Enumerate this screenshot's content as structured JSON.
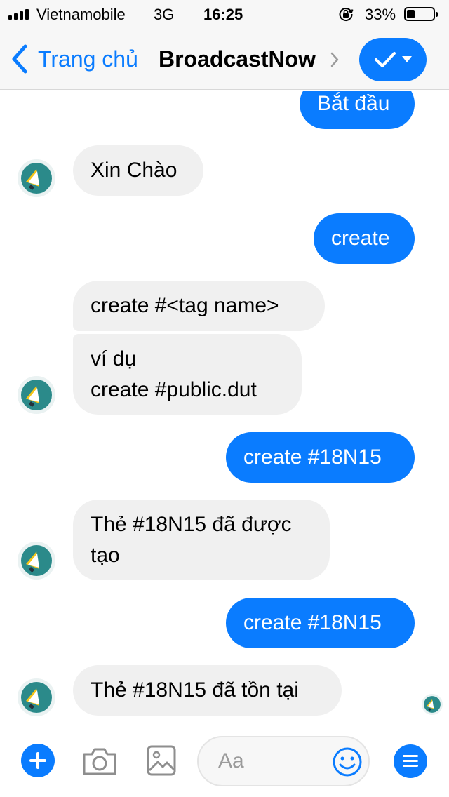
{
  "status_bar": {
    "carrier": "Vietnamobile",
    "network": "3G",
    "time": "16:25",
    "battery_percent": "33%",
    "battery_level": 0.33,
    "icons": [
      "signal-icon",
      "rotation-lock-icon",
      "battery-icon"
    ]
  },
  "nav": {
    "back_label": "Trang chủ",
    "title": "BroadcastNow",
    "icons": [
      "chevron-left-icon",
      "chevron-right-icon",
      "checkmark-icon",
      "caret-down-icon"
    ],
    "accent_color": "#0a7cff"
  },
  "messages": [
    {
      "direction": "out",
      "text": "Bắt đầu"
    },
    {
      "direction": "in",
      "text": "Xin Chào"
    },
    {
      "direction": "out",
      "text": "create"
    },
    {
      "direction": "in",
      "text": "create #<tag name>"
    },
    {
      "direction": "in",
      "text": "ví dụ\ncreate #public.dut"
    },
    {
      "direction": "out",
      "text": "create #18N15"
    },
    {
      "direction": "in",
      "text": "Thẻ #18N15 đã được\ntạo"
    },
    {
      "direction": "out",
      "text": "create #18N15"
    },
    {
      "direction": "in",
      "text": "Thẻ #18N15 đã tồn tại"
    }
  ],
  "composer": {
    "placeholder": "Aa",
    "icons": [
      "plus-icon",
      "camera-icon",
      "image-icon",
      "emoji-icon",
      "menu-icon"
    ]
  },
  "colors": {
    "outgoing_bubble": "#0a7cff",
    "incoming_bubble": "#f0f0f0",
    "bar_background": "#f7f7f7"
  }
}
